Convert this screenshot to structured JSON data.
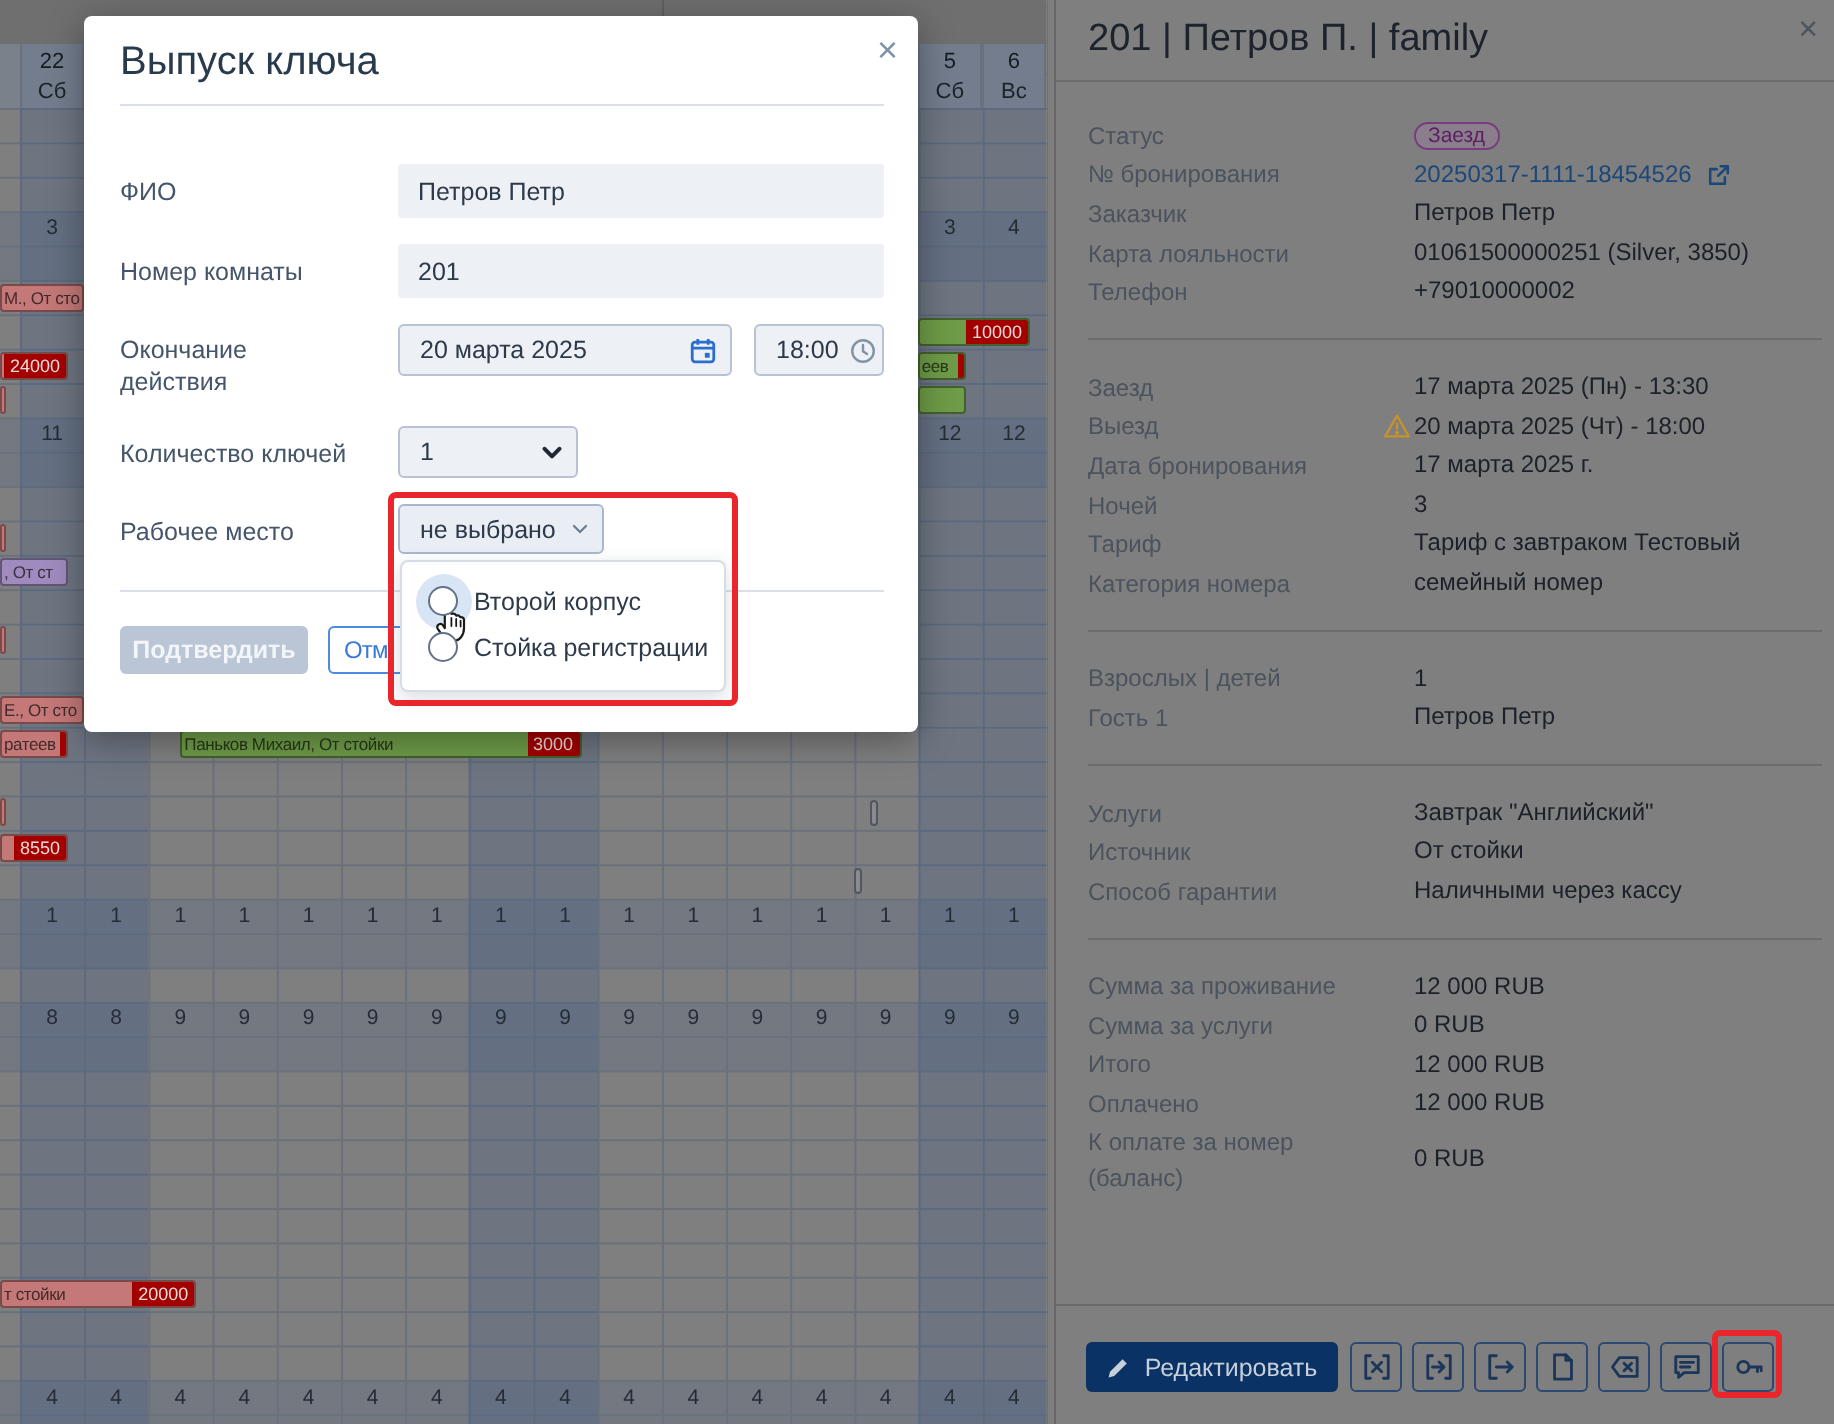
{
  "calendar": {
    "days": [
      {
        "date": "22",
        "weekday": "Сб",
        "weekend": true
      },
      {
        "weekend": true
      },
      {
        "weekend": false
      },
      {
        "weekend": false
      },
      {
        "weekend": false
      },
      {
        "weekend": false
      },
      {
        "weekend": false
      },
      {
        "weekend": true
      },
      {
        "weekend": true
      },
      {
        "weekend": false
      },
      {
        "weekend": false
      },
      {
        "weekend": false
      },
      {
        "weekend": false
      },
      {
        "weekend": false
      },
      {
        "date": "5",
        "weekday": "Сб",
        "weekend": true
      },
      {
        "date": "6",
        "weekday": "Вс",
        "weekend": true
      }
    ],
    "availability": [
      {
        "counts": [
          "3",
          "3",
          "4"
        ]
      },
      {
        "counts": [
          "11",
          "12",
          "12"
        ]
      },
      {
        "counts": [
          "1",
          "1",
          "1",
          "1",
          "1",
          "1",
          "1",
          "1",
          "1",
          "1",
          "1",
          "1",
          "1",
          "1",
          "1",
          "1"
        ]
      },
      {
        "counts": [
          "8",
          "8",
          "9",
          "9",
          "9",
          "9",
          "9",
          "9",
          "9",
          "9",
          "9",
          "9",
          "9",
          "9",
          "9",
          "9"
        ]
      },
      {
        "counts": [
          "4",
          "4",
          "4",
          "4",
          "4",
          "4",
          "4",
          "4",
          "4",
          "4",
          "4",
          "4",
          "4",
          "4",
          "4",
          "4"
        ]
      }
    ],
    "bookings": [
      {
        "label": "М., От сто",
        "color": "#c47878",
        "flagged": false
      },
      {
        "amount": "10000",
        "color": "#6e9c48",
        "flagged": false
      },
      {
        "amount": "24000",
        "color": "#c47878",
        "flagged": false
      },
      {
        "label": "еев",
        "color": "#6e9c48",
        "flagged": true
      },
      {
        "color": "#c47878",
        "flagged": false
      },
      {
        "color": "#6e9c48",
        "flagged": false
      },
      {
        "color": "#c47878",
        "flagged": false
      },
      {
        "label": ", От ст",
        "color": "#9f8bbd",
        "flagged": false
      },
      {
        "color": "#c47878",
        "flagged": false
      },
      {
        "label": "Е., От сто",
        "color": "#c47878",
        "flagged": false
      },
      {
        "label": "ратеев",
        "color": "#c47878",
        "flagged": true
      },
      {
        "label": "Паньков Михаил, От стойки",
        "amount": "3000",
        "color": "#6e9c48",
        "flagged": false
      },
      {
        "color": "#c47878",
        "flagged": false
      },
      {
        "amount": "8550",
        "color": "#c47878",
        "flagged": false
      },
      {
        "label": "т стойки",
        "amount": "20000",
        "color": "#c47878",
        "flagged": false
      }
    ]
  },
  "booking_panel": {
    "title": "201 | Петров П. | family",
    "close": "×",
    "sections": [
      {
        "rows": [
          {
            "kind": "badge",
            "label": "Статус",
            "value": "Заезд",
            "warning": false
          },
          {
            "kind": "link",
            "label": "№ бронирования",
            "value": "20250317-1111-18454526",
            "warning": false
          },
          {
            "kind": "text",
            "label": "Заказчик",
            "value": "Петров Петр",
            "warning": false
          },
          {
            "kind": "text",
            "label": "Карта лояльности",
            "value": "01061500000251 (Silver, 3850)",
            "warning": false
          },
          {
            "kind": "text",
            "label": "Телефон",
            "value": "+79010000002",
            "warning": false
          }
        ]
      },
      {
        "rows": [
          {
            "kind": "text",
            "label": "Заезд",
            "value": "17 марта 2025 (Пн) - 13:30",
            "warning": false
          },
          {
            "kind": "text",
            "label": "Выезд",
            "value": "20 марта 2025 (Чт) - 18:00",
            "warning": true
          },
          {
            "kind": "text",
            "label": "Дата бронирования",
            "value": "17 марта 2025 г.",
            "warning": false
          },
          {
            "kind": "text",
            "label": "Ночей",
            "value": "3",
            "warning": false
          },
          {
            "kind": "text",
            "label": "Тариф",
            "value": "Тариф с завтраком Тестовый",
            "warning": false
          },
          {
            "kind": "text",
            "label": "Категория номера",
            "value": "семейный номер",
            "warning": false
          }
        ]
      },
      {
        "rows": [
          {
            "kind": "text",
            "label": "Взрослых | детей",
            "value": "1",
            "warning": false
          },
          {
            "kind": "text",
            "label": "Гость 1",
            "value": "Петров Петр",
            "warning": false
          }
        ]
      },
      {
        "rows": [
          {
            "kind": "text",
            "label": "Услуги",
            "value": "Завтрак \"Английский\"",
            "warning": false
          },
          {
            "kind": "text",
            "label": "Источник",
            "value": "От стойки",
            "warning": false
          },
          {
            "kind": "text",
            "label": "Способ гарантии",
            "value": "Наличными через кассу",
            "warning": false
          }
        ]
      },
      {
        "rows": [
          {
            "kind": "text",
            "label": "Сумма за проживание",
            "value": "12 000 RUB",
            "warning": false
          },
          {
            "kind": "text",
            "label": "Сумма за услуги",
            "value": "0 RUB",
            "warning": false
          },
          {
            "kind": "text",
            "label": "Итого",
            "value": "12 000 RUB",
            "warning": false
          },
          {
            "kind": "text",
            "label": "Оплачено",
            "value": "12 000 RUB",
            "warning": false
          },
          {
            "kind": "text",
            "label": "К оплате за номер (баланс)",
            "value": "0 RUB",
            "warning": false
          }
        ]
      }
    ],
    "actions": {
      "edit": "Редактировать",
      "tools": [
        {
          "kind": "cancel",
          "highlighted": false
        },
        {
          "kind": "checkin",
          "highlighted": false
        },
        {
          "kind": "checkout",
          "highlighted": false
        },
        {
          "kind": "document",
          "highlighted": false
        },
        {
          "kind": "erase",
          "highlighted": false
        },
        {
          "kind": "comment",
          "highlighted": false
        },
        {
          "kind": "key",
          "highlighted": true
        }
      ]
    }
  },
  "key_dialog": {
    "title": "Выпуск ключа",
    "close": "×",
    "fields": [
      {
        "kind": "text",
        "label": "ФИО",
        "value": "Петров Петр"
      },
      {
        "kind": "text",
        "label": "Номер комнаты",
        "value": "201"
      },
      {
        "kind": "datetime",
        "label": "Окончание действия",
        "date": "20 марта 2025",
        "time": "18:00"
      },
      {
        "kind": "select",
        "label": "Количество ключей",
        "value": "1"
      },
      {
        "kind": "dropdown",
        "label": "Рабочее место",
        "value": "не выбрано",
        "expanded": true,
        "highlighted": true,
        "options": [
          {
            "label": "Второй корпус",
            "selected": false,
            "hovered": true
          },
          {
            "label": "Стойка регистрации",
            "selected": false,
            "hovered": false
          }
        ]
      }
    ],
    "buttons": [
      {
        "kind": "primary",
        "label": "Подтвердить",
        "disabled": true
      },
      {
        "kind": "secondary",
        "label": "Отм",
        "disabled": false
      }
    ]
  }
}
